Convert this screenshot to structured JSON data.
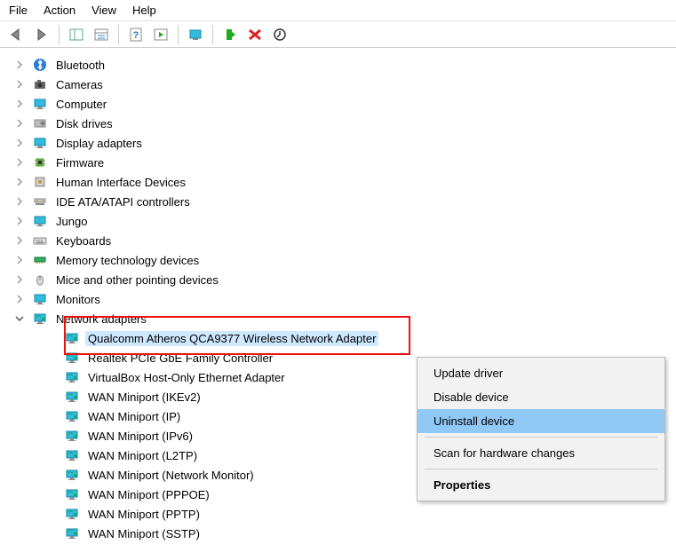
{
  "menu": {
    "file": "File",
    "action": "Action",
    "view": "View",
    "help": "Help"
  },
  "tree": {
    "items": [
      {
        "label": "Bluetooth",
        "icon": "bluetooth"
      },
      {
        "label": "Cameras",
        "icon": "camera"
      },
      {
        "label": "Computer",
        "icon": "monitor"
      },
      {
        "label": "Disk drives",
        "icon": "disk"
      },
      {
        "label": "Display adapters",
        "icon": "monitor"
      },
      {
        "label": "Firmware",
        "icon": "chip"
      },
      {
        "label": "Human Interface Devices",
        "icon": "hid"
      },
      {
        "label": "IDE ATA/ATAPI controllers",
        "icon": "ide"
      },
      {
        "label": "Jungo",
        "icon": "monitor"
      },
      {
        "label": "Keyboards",
        "icon": "keyboard"
      },
      {
        "label": "Memory technology devices",
        "icon": "memory"
      },
      {
        "label": "Mice and other pointing devices",
        "icon": "mouse"
      },
      {
        "label": "Monitors",
        "icon": "monitor"
      },
      {
        "label": "Network adapters",
        "icon": "network",
        "expanded": true
      }
    ],
    "network_children": [
      {
        "label": "Qualcomm Atheros QCA9377 Wireless Network Adapter",
        "selected": true
      },
      {
        "label": "Realtek PCIe GbE Family Controller"
      },
      {
        "label": "VirtualBox Host-Only Ethernet Adapter"
      },
      {
        "label": "WAN Miniport (IKEv2)"
      },
      {
        "label": "WAN Miniport (IP)"
      },
      {
        "label": "WAN Miniport (IPv6)"
      },
      {
        "label": "WAN Miniport (L2TP)"
      },
      {
        "label": "WAN Miniport (Network Monitor)"
      },
      {
        "label": "WAN Miniport (PPPOE)"
      },
      {
        "label": "WAN Miniport (PPTP)"
      },
      {
        "label": "WAN Miniport (SSTP)"
      }
    ]
  },
  "context_menu": {
    "update": "Update driver",
    "disable": "Disable device",
    "uninstall": "Uninstall device",
    "scan": "Scan for hardware changes",
    "properties": "Properties"
  }
}
